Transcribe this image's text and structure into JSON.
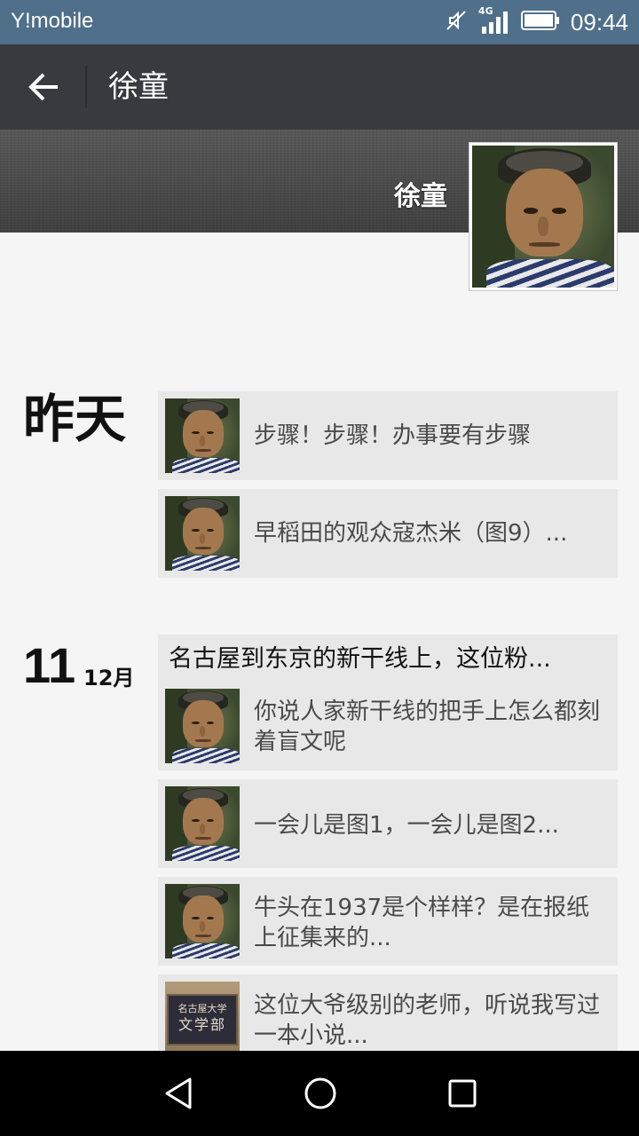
{
  "status_bar": {
    "carrier": "Y!mobile",
    "network": "4G",
    "time": "09:44"
  },
  "action_bar": {
    "title": "徐童"
  },
  "cover": {
    "name": "徐童"
  },
  "timeline": {
    "groups": [
      {
        "date_label": "昨天",
        "entries": [
          {
            "text": "步骤！步骤！办事要有步骤",
            "thumb": "avatar"
          },
          {
            "text": "早稻田的观众寇杰米（图9）...",
            "thumb": "avatar"
          }
        ]
      },
      {
        "day": "11",
        "month": "12月",
        "headline": "名古屋到东京的新干线上，这位粉...",
        "entries": [
          {
            "text": "你说人家新干线的把手上怎么都刻着盲文呢",
            "thumb": "avatar"
          },
          {
            "text": "一会儿是图1，一会儿是图2...",
            "thumb": "avatar"
          },
          {
            "text": "牛头在1937是个样样？是在报纸上征集来的...",
            "thumb": "avatar"
          },
          {
            "text": "这位大爷级别的老师，听说我写过一本小说...",
            "thumb": "sign"
          }
        ]
      }
    ]
  },
  "sign_thumb": {
    "line1": "名古屋大学",
    "line2": "文学部"
  },
  "nav_bar": {
    "back": "back-triangle-icon",
    "home": "home-circle-icon",
    "recents": "recents-square-icon"
  }
}
